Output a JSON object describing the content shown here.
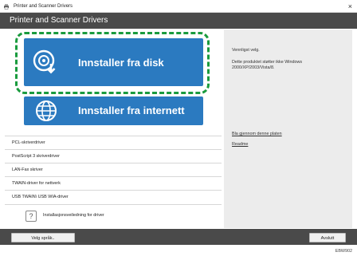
{
  "window": {
    "title": "Printer and Scanner Drivers",
    "header_title": "Printer and Scanner Drivers",
    "close_symbol": "×"
  },
  "main_buttons": {
    "install_from_disk": {
      "label": "Innstaller fra disk",
      "icon": "disk-install-icon"
    },
    "install_from_internet": {
      "label": "Innstaller fra internett",
      "icon": "globe-icon"
    }
  },
  "driver_list": [
    "PCL-skriverdriver",
    "PostScript 3 skriverdriver",
    "LAN-Fax skriver",
    "TWAIN-driver for nettverk",
    "USB TWAIN\\ USB WIA-driver"
  ],
  "help_item": {
    "label": "Installasjonsveiledning for driver",
    "icon": "question-icon"
  },
  "info_panel": {
    "prompt": "Vennligst velg.",
    "unsupported_line1": "Dette produktet støtter ikke Windows",
    "unsupported_line2": "2000/XP/2003/Vista/8.",
    "browse_link": "Bla gjennom denne platen",
    "readme_link": "Readme"
  },
  "footer": {
    "language_button": "Velg språk..",
    "quit_button": "Avslutt",
    "image_code": "EBW902"
  },
  "colors": {
    "header_bg": "#4a4a4a",
    "button_blue": "#2b7ac0",
    "highlight_dash": "#1a9b3e",
    "side_panel": "#ececec"
  }
}
